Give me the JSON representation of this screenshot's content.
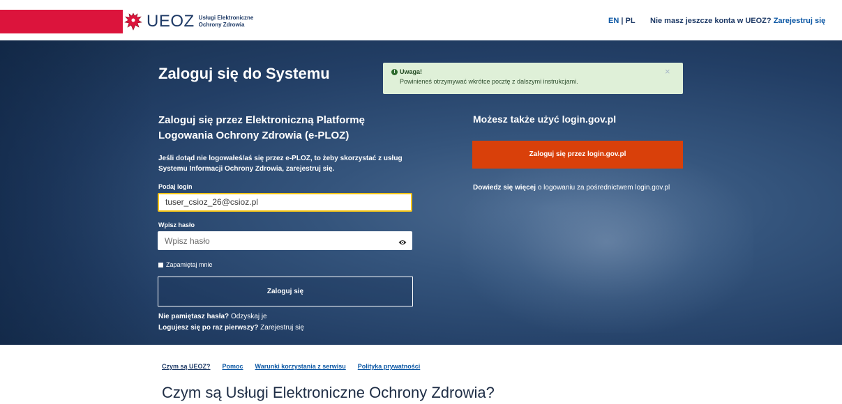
{
  "header": {
    "logo_text": "UEOZ",
    "logo_subtitle_line1": "Usługi Elektroniczne",
    "logo_subtitle_line2": "Ochrony Zdrowia",
    "lang_en": "EN",
    "lang_sep": " | ",
    "lang_pl": "PL",
    "no_account_text": "Nie masz jeszcze konta w UEOZ?",
    "register_link": "Zarejestruj się"
  },
  "hero": {
    "title": "Zaloguj się do Systemu",
    "alert": {
      "icon": "exclamation-circle-icon",
      "title": "Uwaga!",
      "text": "Powinieneś otrzymywać wkrótce pocztę z dalszymi instrukcjami.",
      "close": "×"
    },
    "left": {
      "heading": "Zaloguj się przez Elektroniczną Platformę Logowania Ochrony Zdrowia (e-PLOZ)",
      "description": "Jeśli dotąd nie logowałeś/aś się przez e-PLOZ, to żeby skorzystać z usług Systemu Informacji Ochrony Zdrowia, zarejestruj się.",
      "login_label": "Podaj login",
      "login_value": "tuser_csioz_26@csioz.pl",
      "password_label": "Wpisz hasło",
      "password_placeholder": "Wpisz hasło",
      "remember_label": "Zapamiętaj mnie",
      "login_button": "Zaloguj się",
      "forgot_question": "Nie pamiętasz hasła?",
      "forgot_link": "Odzyskaj je",
      "first_question": "Logujesz się po raz pierwszy?",
      "first_link": "Zarejestruj się"
    },
    "right": {
      "heading": "Możesz także użyć login.gov.pl",
      "gov_button": "Zaloguj się przez login.gov.pl",
      "learn_bold": "Dowiedz się więcej",
      "learn_rest": "o logowaniu za pośrednictwem login.gov.pl"
    }
  },
  "footer": {
    "links": [
      "Czym są UEOZ?",
      "Pomoc",
      "Warunki korzystania z serwisu",
      "Polityka prywatności"
    ],
    "section_title": "Czym są Usługi Elektroniczne Ochrony Zdrowia?"
  },
  "colors": {
    "red_strip": "#dc143c",
    "gov_button": "#d9400a",
    "link_blue": "#0b57a4",
    "alert_bg": "#dff0d8"
  }
}
